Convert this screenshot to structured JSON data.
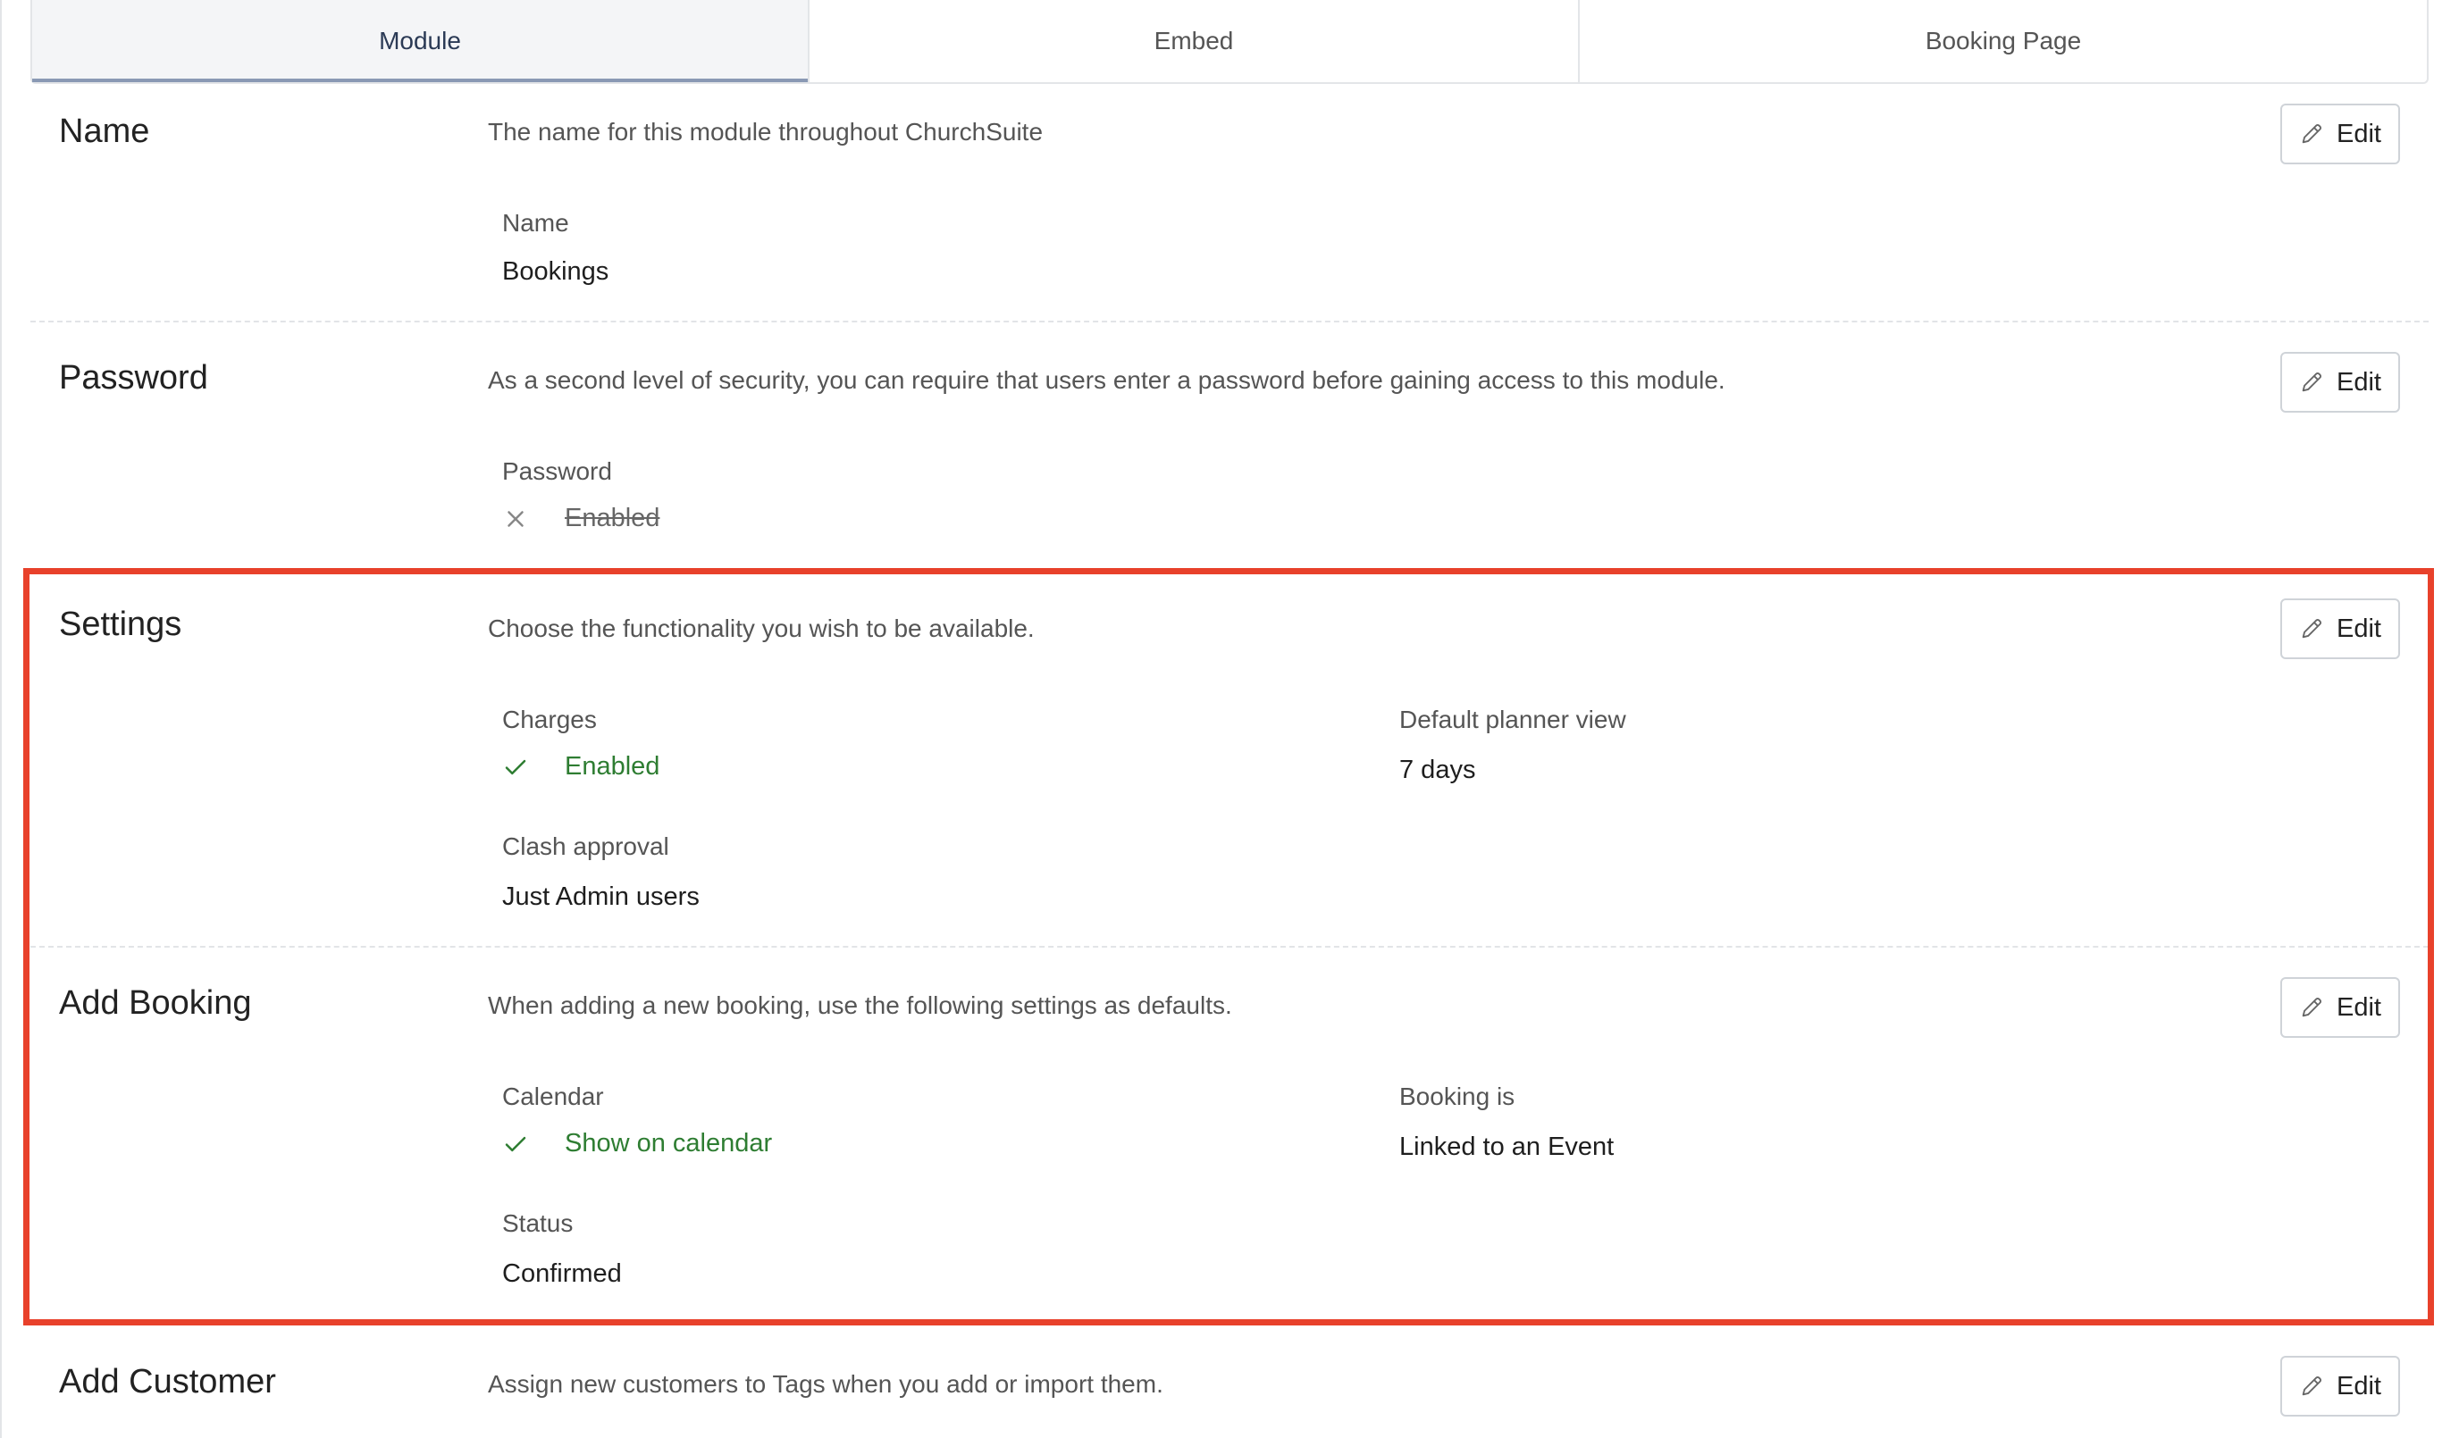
{
  "tabs": [
    {
      "label": "Module",
      "active": true
    },
    {
      "label": "Embed",
      "active": false
    },
    {
      "label": "Booking Page",
      "active": false
    }
  ],
  "edit_label": "Edit",
  "icons": {
    "edit": "pencil-icon",
    "enabled": "check-icon",
    "disabled": "cross-icon"
  },
  "colors": {
    "enabled_green": "#2e7d32",
    "highlight_red": "#e8412b",
    "active_tab_underline": "#8a99b4"
  },
  "sections": {
    "name": {
      "title": "Name",
      "description": "The name for this module throughout ChurchSuite",
      "fields": {
        "name_label": "Name",
        "name_value": "Bookings"
      }
    },
    "password": {
      "title": "Password",
      "description": "As a second level of security, you can require that users enter a password before gaining access to this module.",
      "fields": {
        "password_label": "Password",
        "password_value": "Enabled",
        "password_enabled": false
      }
    },
    "settings": {
      "title": "Settings",
      "description": "Choose the functionality you wish to be available.",
      "fields": {
        "charges_label": "Charges",
        "charges_value": "Enabled",
        "charges_enabled": true,
        "planner_label": "Default planner view",
        "planner_value": "7 days",
        "clash_label": "Clash approval",
        "clash_value": "Just Admin users"
      }
    },
    "add_booking": {
      "title": "Add Booking",
      "description": "When adding a new booking, use the following settings as defaults.",
      "fields": {
        "calendar_label": "Calendar",
        "calendar_value": "Show on calendar",
        "calendar_enabled": true,
        "booking_is_label": "Booking is",
        "booking_is_value": "Linked to an Event",
        "status_label": "Status",
        "status_value": "Confirmed"
      }
    },
    "add_customer": {
      "title": "Add Customer",
      "description": "Assign new customers to Tags when you add or import them."
    }
  }
}
